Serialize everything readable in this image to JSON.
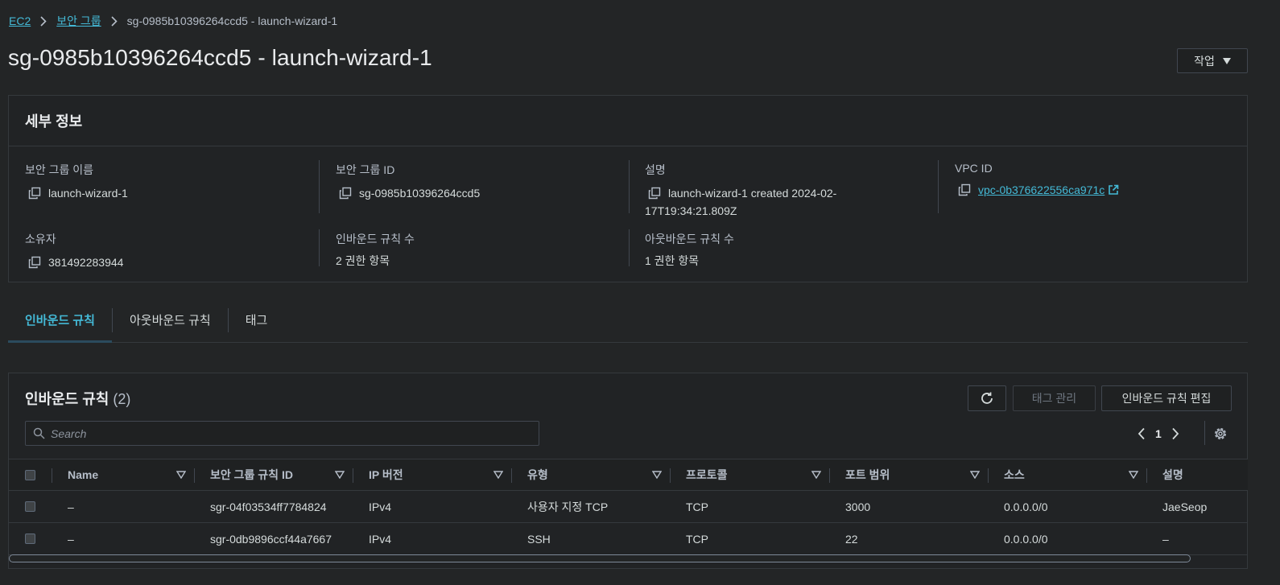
{
  "breadcrumb": {
    "items": [
      "EC2",
      "보안 그룹"
    ],
    "current": "sg-0985b10396264ccd5 - launch-wizard-1"
  },
  "page": {
    "title": "sg-0985b10396264ccd5 - launch-wizard-1",
    "actions_label": "작업"
  },
  "details": {
    "header": "세부 정보",
    "group_name_label": "보안 그룹 이름",
    "group_name": "launch-wizard-1",
    "group_id_label": "보안 그룹 ID",
    "group_id": "sg-0985b10396264ccd5",
    "description_label": "설명",
    "description_line1": "launch-wizard-1 created 2024-02-",
    "description_line2": "17T19:34:21.809Z",
    "vpc_label": "VPC ID",
    "vpc_id": "vpc-0b376622556ca971c",
    "owner_label": "소유자",
    "owner": "381492283944",
    "inbound_count_label": "인바운드 규칙 수",
    "inbound_count": "2 권한 항목",
    "outbound_count_label": "아웃바운드 규칙 수",
    "outbound_count": "1 권한 항목"
  },
  "tabs": [
    {
      "label": "인바운드 규칙",
      "active": true
    },
    {
      "label": "아웃바운드 규칙",
      "active": false
    },
    {
      "label": "태그",
      "active": false
    }
  ],
  "rules": {
    "title": "인바운드 규칙",
    "count": "(2)",
    "manage_tags_label": "태그 관리",
    "edit_rules_label": "인바운드 규칙 편집",
    "search_placeholder": "Search",
    "page_number": "1",
    "columns": [
      "Name",
      "보안 그룹 규칙 ID",
      "IP 버전",
      "유형",
      "프로토콜",
      "포트 범위",
      "소스",
      "설명"
    ],
    "rows": [
      {
        "name": "–",
        "rule_id": "sgr-04f03534ff7784824",
        "ip_version": "IPv4",
        "type": "사용자 지정 TCP",
        "protocol": "TCP",
        "port_range": "3000",
        "source": "0.0.0.0/0",
        "description": "JaeSeop"
      },
      {
        "name": "–",
        "rule_id": "sgr-0db9896ccf44a7667",
        "ip_version": "IPv4",
        "type": "SSH",
        "protocol": "TCP",
        "port_range": "22",
        "source": "0.0.0.0/0",
        "description": "–"
      }
    ]
  },
  "colors": {
    "background": "#232526",
    "link": "#44b9d6",
    "border": "#414750"
  },
  "icons": [
    "chevron-right-icon",
    "caret-down-icon",
    "copy-icon",
    "external-link-icon",
    "refresh-icon",
    "search-icon",
    "chevron-left-icon",
    "settings-icon",
    "sort-icon"
  ]
}
